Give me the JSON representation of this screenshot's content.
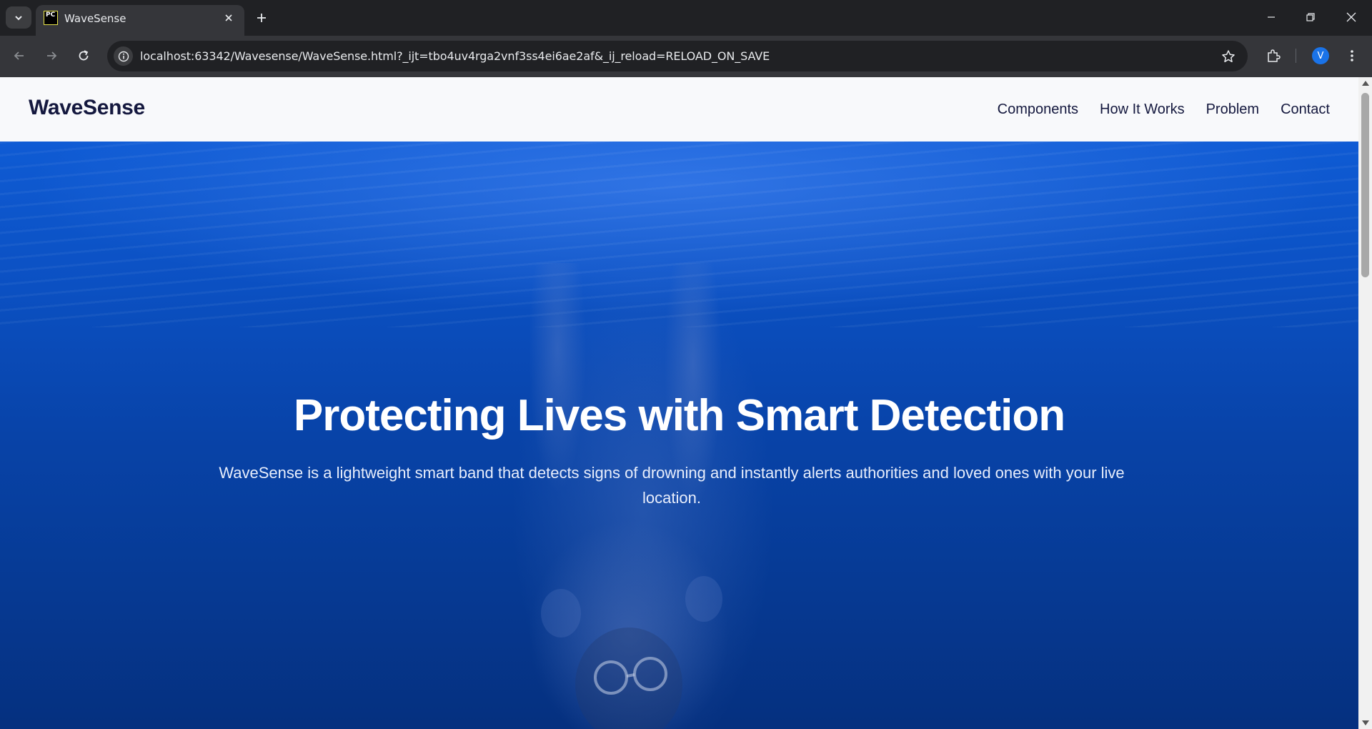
{
  "browser": {
    "tab_title": "WaveSense",
    "favicon_text": "PC",
    "url": "localhost:63342/Wavesense/WaveSense.html?_ijt=tbo4uv4rga2vnf3ss4ei6ae2af&_ij_reload=RELOAD_ON_SAVE",
    "profile_initial": "V"
  },
  "site": {
    "logo": "WaveSense",
    "nav": [
      "Components",
      "How It Works",
      "Problem",
      "Contact"
    ]
  },
  "hero": {
    "title": "Protecting Lives with Smart Detection",
    "subtitle": "WaveSense is a lightweight smart band that detects signs of drowning and instantly alerts authorities and loved ones with your live location."
  },
  "colors": {
    "brand_dark": "#14183e",
    "hero_blue": "#0b50c2"
  }
}
